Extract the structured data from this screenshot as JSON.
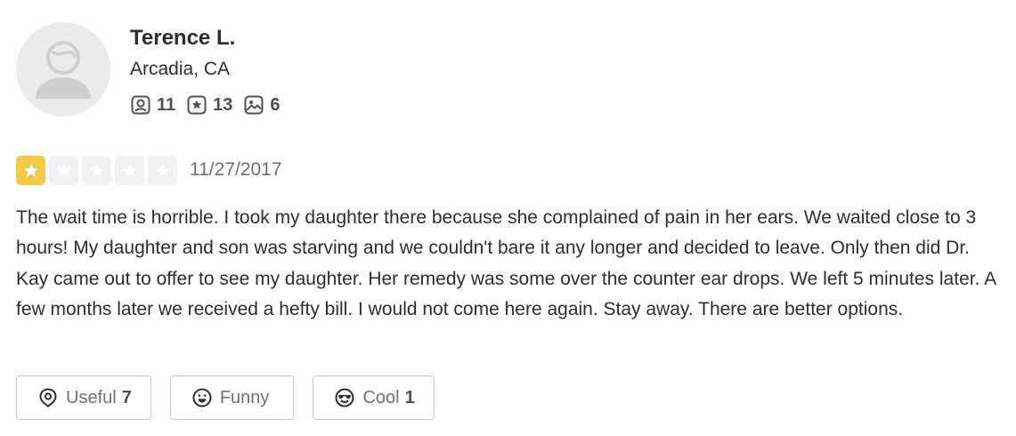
{
  "user": {
    "name": "Terence L.",
    "location": "Arcadia, CA",
    "stats": [
      {
        "icon": "friends-icon",
        "value": "11"
      },
      {
        "icon": "reviews-star-icon",
        "value": "13"
      },
      {
        "icon": "photos-icon",
        "value": "6"
      }
    ]
  },
  "review": {
    "rating": 1,
    "max_rating": 5,
    "date": "11/27/2017",
    "text": "The wait time is horrible. I took my daughter there because she complained of pain in her ears. We waited close to 3 hours! My daughter and son was starving and we couldn't bare it any longer and decided to leave. Only then did Dr. Kay came out to offer to see my daughter. Her remedy was some over the counter ear drops. We left 5 minutes later. A few months later we received a hefty bill. I would not come here again. Stay away. There are better options."
  },
  "reactions": [
    {
      "icon": "useful-icon",
      "label": "Useful",
      "count": "7"
    },
    {
      "icon": "funny-icon",
      "label": "Funny",
      "count": ""
    },
    {
      "icon": "cool-icon",
      "label": "Cool",
      "count": "1"
    }
  ],
  "colors": {
    "star_filled": "#f1c94b",
    "star_empty": "#f1f1f1",
    "avatar_bg": "#ebebeb",
    "text": "#2d2e2f",
    "muted": "#6e7072"
  }
}
